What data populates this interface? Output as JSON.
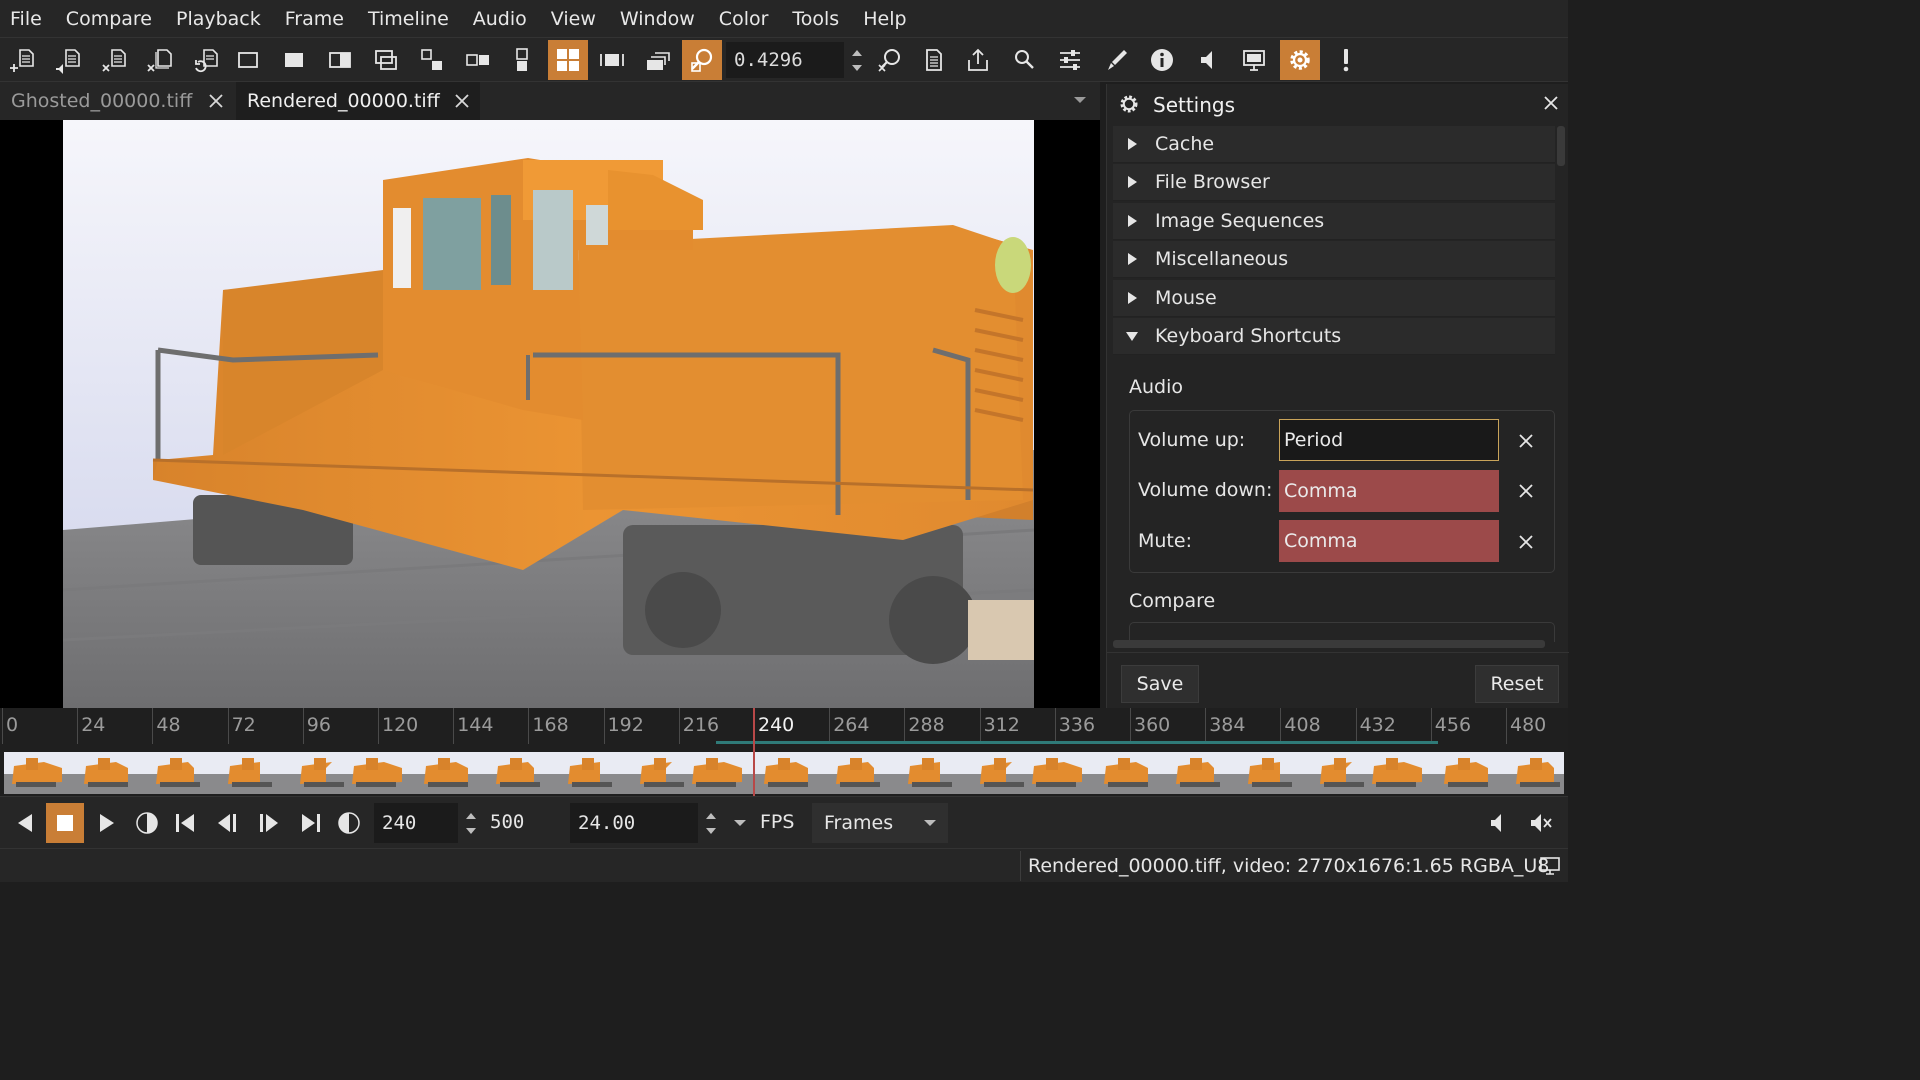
{
  "menu": [
    "File",
    "Compare",
    "Playback",
    "Frame",
    "Timeline",
    "Audio",
    "View",
    "Window",
    "Color",
    "Tools",
    "Help"
  ],
  "toolbar": {
    "zoom_value": "0.4296",
    "icons": [
      "file-open-icon",
      "file-open-separate-audio-icon",
      "file-close-icon",
      "file-close-all-icon",
      "file-reload-icon",
      "compare-a-icon",
      "compare-b-icon",
      "compare-wipe-icon",
      "compare-overlay-icon",
      "compare-difference-icon",
      "compare-horizontal-icon",
      "compare-vertical-icon",
      "compare-tile-icon",
      "frame-view-icon",
      "fill-view-icon",
      "zoom-icon",
      "zoom-reset-icon",
      "files-panel-icon",
      "export-icon",
      "search-icon",
      "adjustments-icon",
      "annotation-icon",
      "info-icon",
      "audio-icon",
      "display-icon",
      "settings-icon",
      "messages-icon"
    ],
    "active": [
      "compare-tile-icon",
      "zoom-icon",
      "settings-icon"
    ]
  },
  "tabs": [
    {
      "label": "Ghosted_00000.tiff",
      "active": false
    },
    {
      "label": "Rendered_00000.tiff",
      "active": true
    }
  ],
  "settings": {
    "title": "Settings",
    "sections": [
      "Cache",
      "File Browser",
      "Image Sequences",
      "Miscellaneous",
      "Mouse",
      "Keyboard Shortcuts"
    ],
    "expanded_section": "Keyboard Shortcuts",
    "groups": {
      "audio": {
        "title": "Audio",
        "shortcuts": [
          {
            "label": "Volume up:",
            "value": "Period",
            "conflict": false
          },
          {
            "label": "Volume down:",
            "value": "Comma",
            "conflict": true
          },
          {
            "label": "Mute:",
            "value": "Comma",
            "conflict": true
          }
        ]
      },
      "compare": {
        "title": "Compare"
      }
    },
    "save_label": "Save",
    "reset_label": "Reset"
  },
  "timeline": {
    "ticks": [
      "0",
      "24",
      "48",
      "72",
      "96",
      "120",
      "144",
      "168",
      "192",
      "216",
      "240",
      "264",
      "288",
      "312",
      "336",
      "360",
      "384",
      "408",
      "432",
      "456",
      "480"
    ],
    "current_frame": "240"
  },
  "playback": {
    "current_frame": "240",
    "end_frame": "500",
    "fps_value": "24.00",
    "fps_label": "FPS",
    "time_units": "Frames"
  },
  "status": {
    "text": "Rendered_00000.tiff, video: 2770x1676:1.65 RGBA_U8"
  },
  "colors": {
    "accent": "#c97e36",
    "conflict": "#9c4a4a",
    "playhead": "#b84848",
    "cache": "#2f7a78"
  }
}
